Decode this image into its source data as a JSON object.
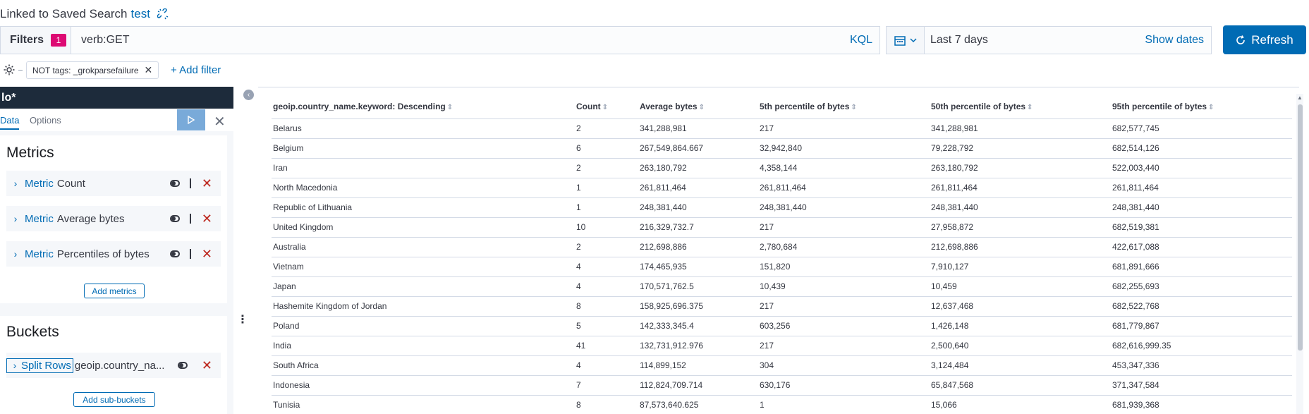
{
  "saved_search": {
    "prefix": "Linked to Saved Search",
    "name": "test"
  },
  "query_bar": {
    "filters_label": "Filters",
    "filters_count": "1",
    "query_value": "verb:GET",
    "language": "KQL"
  },
  "date_picker": {
    "range": "Last 7 days",
    "show_dates": "Show dates"
  },
  "refresh_label": "Refresh",
  "filter_pills": [
    {
      "label": "NOT tags: _grokparsefailure"
    }
  ],
  "add_filter_label": "+ Add filter",
  "sidebar": {
    "index_pattern": "lo*",
    "tabs": [
      "Data",
      "Options"
    ],
    "metrics_title": "Metrics",
    "metrics": [
      {
        "kind": "Metric",
        "label": "Count"
      },
      {
        "kind": "Metric",
        "label": "Average bytes"
      },
      {
        "kind": "Metric",
        "label": "Percentiles of bytes"
      }
    ],
    "add_metrics_label": "Add metrics",
    "buckets_title": "Buckets",
    "buckets": [
      {
        "kind": "Split Rows",
        "label": "geoip.country_na..."
      }
    ],
    "add_buckets_label": "Add sub-buckets"
  },
  "colors": {
    "accent": "#006bb4",
    "nav_dark": "#1d2b3b",
    "badge": "#dd0a73",
    "danger": "#bd271e"
  },
  "table": {
    "columns": [
      "geoip.country_name.keyword: Descending",
      "Count",
      "Average bytes",
      "5th percentile of bytes",
      "50th percentile of bytes",
      "95th percentile of bytes"
    ],
    "rows": [
      [
        "Belarus",
        "2",
        "341,288,981",
        "217",
        "341,288,981",
        "682,577,745"
      ],
      [
        "Belgium",
        "6",
        "267,549,864.667",
        "32,942,840",
        "79,228,792",
        "682,514,126"
      ],
      [
        "Iran",
        "2",
        "263,180,792",
        "4,358,144",
        "263,180,792",
        "522,003,440"
      ],
      [
        "North Macedonia",
        "1",
        "261,811,464",
        "261,811,464",
        "261,811,464",
        "261,811,464"
      ],
      [
        "Republic of Lithuania",
        "1",
        "248,381,440",
        "248,381,440",
        "248,381,440",
        "248,381,440"
      ],
      [
        "United Kingdom",
        "10",
        "216,329,732.7",
        "217",
        "27,958,872",
        "682,519,381"
      ],
      [
        "Australia",
        "2",
        "212,698,886",
        "2,780,684",
        "212,698,886",
        "422,617,088"
      ],
      [
        "Vietnam",
        "4",
        "174,465,935",
        "151,820",
        "7,910,127",
        "681,891,666"
      ],
      [
        "Japan",
        "4",
        "170,571,762.5",
        "10,439",
        "10,459",
        "682,255,693"
      ],
      [
        "Hashemite Kingdom of Jordan",
        "8",
        "158,925,696.375",
        "217",
        "12,637,468",
        "682,522,768"
      ],
      [
        "Poland",
        "5",
        "142,333,345.4",
        "603,256",
        "1,426,148",
        "681,779,867"
      ],
      [
        "India",
        "41",
        "132,731,912.976",
        "217",
        "2,500,640",
        "682,616,999.35"
      ],
      [
        "South Africa",
        "4",
        "114,899,152",
        "304",
        "3,124,484",
        "453,347,336"
      ],
      [
        "Indonesia",
        "7",
        "112,824,709.714",
        "630,176",
        "65,847,568",
        "371,347,584"
      ],
      [
        "Tunisia",
        "8",
        "87,573,640.625",
        "1",
        "15,066",
        "681,939,368"
      ]
    ]
  }
}
